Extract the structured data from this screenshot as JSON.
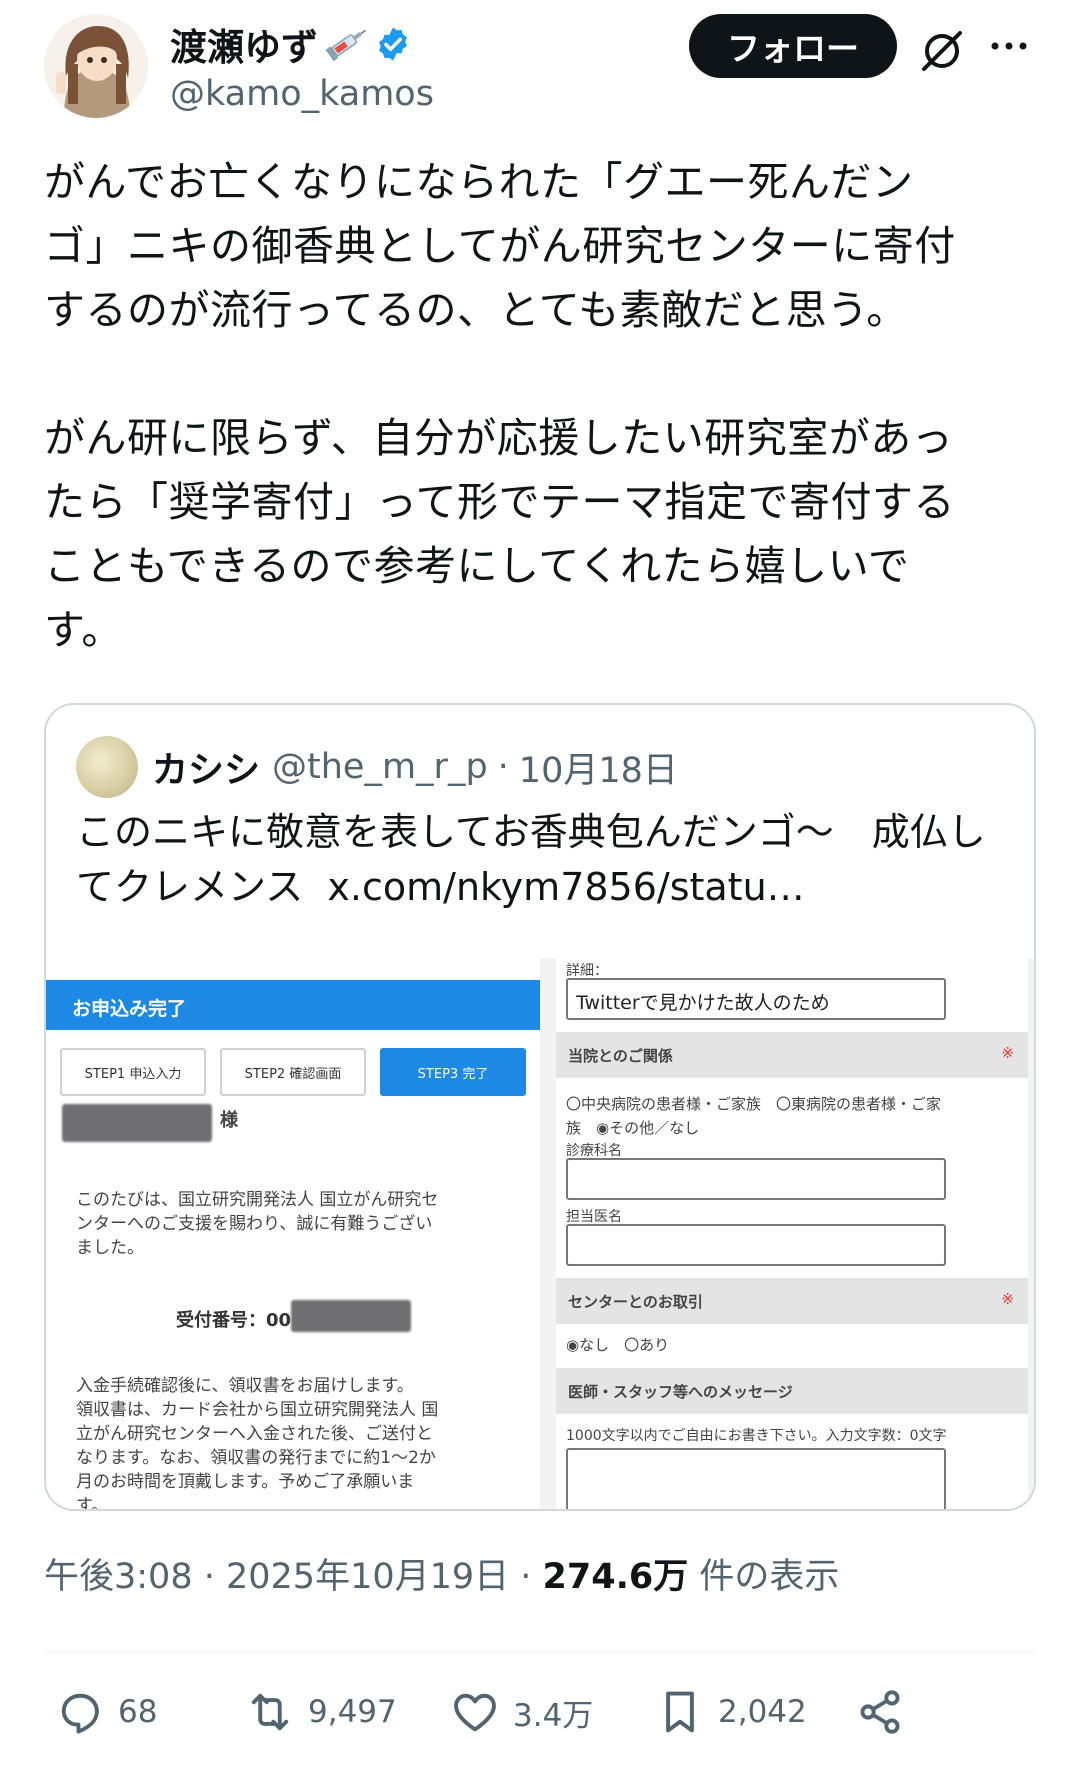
{
  "author": {
    "display_name": "渡瀬ゆず",
    "handle": "@kamo_kamos",
    "follow_label": "フォロー"
  },
  "tweet": {
    "text": "がんでお亡くなりになられた「グエー死んだン\nゴ」ニキの御香典としてがん研究センターに寄付\nするのが流行ってるの、とても素敵だと思う。\n\nがん研に限らず、自分が応援したい研究室があっ\nたら「奨学寄付」って形でテーマ指定で寄付する\nこともできるので参考にしてくれたら嬉しいで\nす。"
  },
  "quote": {
    "name": "カシシ",
    "handle": "@the_m_r_p",
    "sep": "·",
    "date": "10月18日",
    "text": "このニキに敬意を表してお香典包んだンゴ〜　成仏し\nてクレメンス",
    "link": "x.com/nkym7856/statu…",
    "image": {
      "left": {
        "header": "お申込み完了",
        "steps": [
          "STEP1 申込入力",
          "STEP2 確認画面",
          "STEP3 完了"
        ],
        "sama": "様",
        "thanks": "このたびは、国立研究開発法人 国立がん研究セ\nンターへのご支援を賜わり、誠に有難うござい\nました。",
        "receipt_label": "受付番号：00",
        "notice": "入金手続確認後に、領収書をお届けします。\n領収書は、カード会社から国立研究開発法人 国\n立がん研究センターへ入金された後、ご送付と\nなります。なお、領収書の発行までに約1〜2か\n月のお時間を頂戴します。予めご了承願いま\nす。"
      },
      "right": {
        "detail_label": "詳細：",
        "detail_value": "Twitterで見かけた故人のため",
        "relation_title": "当院とのご関係",
        "required_mark": "※",
        "relation_options": "〇中央病院の患者様・ご家族　〇東病院の患者様・ご家\n族　◉その他／なし",
        "dept_label": "診療科名",
        "doctor_label": "担当医名",
        "center_title": "センターとのお取引",
        "center_options": "◉なし　〇あり",
        "message_title": "医師・スタッフ等へのメッセージ",
        "message_hint": "1000文字以内でご自由にお書き下さい。入力文字数：0文字"
      }
    }
  },
  "meta": {
    "time": "午後3:08",
    "sep": " · ",
    "date": "2025年10月19日",
    "views": "274.6万",
    "views_label": " 件の表示"
  },
  "actions": {
    "replies": "68",
    "reposts": "9,497",
    "likes": "3.4万",
    "bookmarks": "2,042"
  }
}
